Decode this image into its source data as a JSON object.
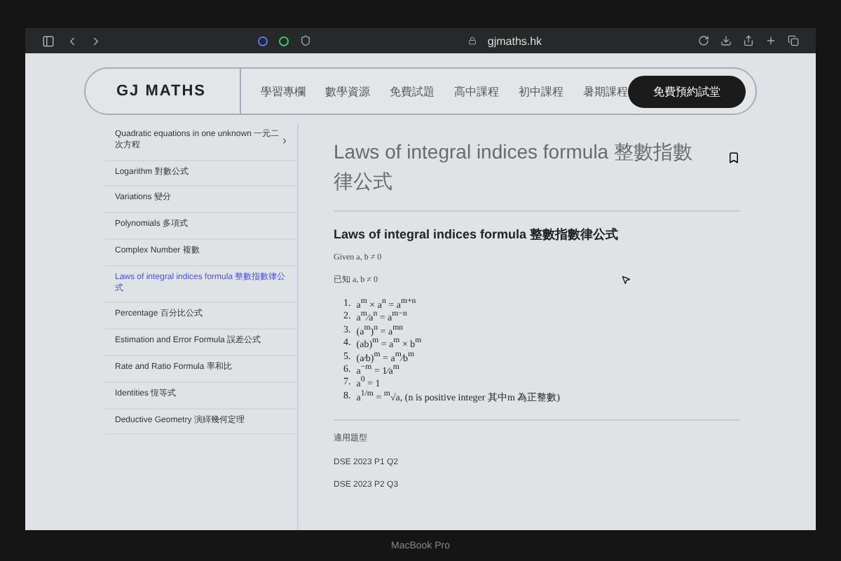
{
  "browser": {
    "url": "gjmaths.hk"
  },
  "header": {
    "logo": "GJ MATHS",
    "nav": [
      {
        "label": "學習專欄"
      },
      {
        "label": "數學資源"
      },
      {
        "label": "免費試題"
      },
      {
        "label": "高中課程"
      },
      {
        "label": "初中課程"
      },
      {
        "label": "暑期課程"
      }
    ],
    "cta": "免費預約試堂"
  },
  "sidebar": {
    "items": [
      {
        "label": "Quadratic equations in one unknown 一元二次方程",
        "selected": false,
        "expandable": true
      },
      {
        "label": "Logarithm 對數公式",
        "selected": false,
        "expandable": false
      },
      {
        "label": "Variations 變分",
        "selected": false,
        "expandable": false
      },
      {
        "label": "Polynomials 多項式",
        "selected": false,
        "expandable": false
      },
      {
        "label": "Complex Number 複數",
        "selected": false,
        "expandable": false
      },
      {
        "label": "Laws of integral indices formula 整數指數律公式",
        "selected": true,
        "expandable": false
      },
      {
        "label": "Percentage 百分比公式",
        "selected": false,
        "expandable": false
      },
      {
        "label": "Estimation and Error Formula 誤差公式",
        "selected": false,
        "expandable": false
      },
      {
        "label": "Rate and Ratio Formula 率和比",
        "selected": false,
        "expandable": false
      },
      {
        "label": "Identities 恆等式",
        "selected": false,
        "expandable": false
      },
      {
        "label": "Deductive Geometry 演繹幾何定理",
        "selected": false,
        "expandable": false
      }
    ]
  },
  "article": {
    "title": "Laws of integral indices formula 整數指數律公式",
    "subtitle": "Laws of integral indices formula 整數指數律公式",
    "given_en": "Given a, b ≠ 0",
    "given_zh": "已知 a, b ≠ 0",
    "formulas": [
      {
        "number": "1.",
        "text": "a$^{m}$ × a$^{n}$ = a$^{m+n}$"
      },
      {
        "number": "2.",
        "text": "a$^{m}$⁄a$^{n}$ = a$^{m−n}$"
      },
      {
        "number": "3.",
        "text": "(a$^{m}$)$^{n}$ = a$^{mn}$"
      },
      {
        "number": "4.",
        "text": "(ab)$^{m}$ = a$^{m}$ × b$^{m}$"
      },
      {
        "number": "5.",
        "text": "(a⁄b)$^{m}$ = a$^{m}$⁄b$^{m}$"
      },
      {
        "number": "6.",
        "text": "a$^{−m}$ = 1⁄a$^{m}$"
      },
      {
        "number": "7.",
        "text": "a$^{0}$ = 1"
      },
      {
        "number": "8.",
        "text": "a$^{1/m}$ = $^{m}$√a, (n is positive integer 其中m 為正整數)"
      }
    ],
    "section_label": "適用題型",
    "questions": [
      "DSE 2023 P1 Q2",
      "DSE 2023 P2 Q3"
    ]
  },
  "device": {
    "label": "MacBook Pro"
  }
}
